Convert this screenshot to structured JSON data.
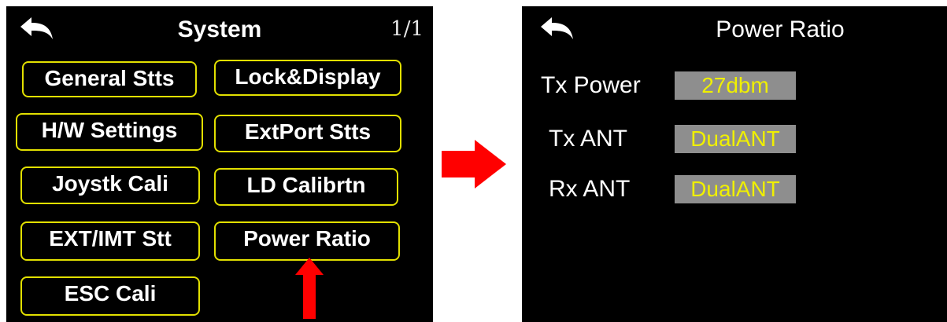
{
  "left_screen": {
    "title": "System",
    "page_indicator": "1/1",
    "back_icon": "back-arrow-icon",
    "menu": [
      {
        "label": "General Stts"
      },
      {
        "label": "Lock&Display"
      },
      {
        "label": "H/W Settings"
      },
      {
        "label": "ExtPort Stts"
      },
      {
        "label": "Joystk Cali"
      },
      {
        "label": "LD Calibrtn"
      },
      {
        "label": "EXT/IMT Stt"
      },
      {
        "label": "Power Ratio"
      },
      {
        "label": "ESC Cali"
      }
    ],
    "highlight_arrow": {
      "icon": "up-arrow-icon",
      "color": "#ff0000"
    }
  },
  "transition_arrow": {
    "icon": "right-arrow-icon",
    "color": "#ff0000"
  },
  "right_screen": {
    "title": "Power Ratio",
    "back_icon": "back-arrow-icon",
    "settings": [
      {
        "label": "Tx Power",
        "value": "27dbm"
      },
      {
        "label": "Tx ANT",
        "value": "DualANT"
      },
      {
        "label": "Rx ANT",
        "value": "DualANT"
      }
    ]
  },
  "colors": {
    "screen_bg": "#000000",
    "button_border": "#e2e000",
    "value_text": "#f0f000",
    "value_bg": "#8e8e8e",
    "arrow": "#ff0000"
  }
}
